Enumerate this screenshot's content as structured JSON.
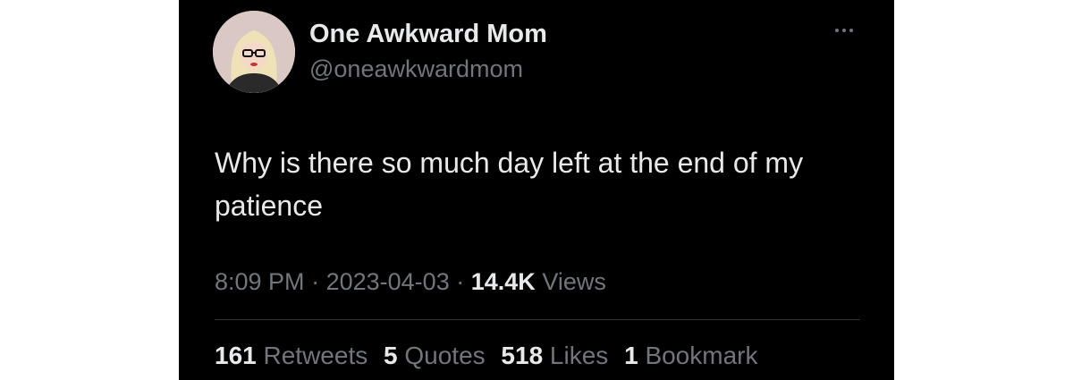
{
  "author": {
    "display_name": "One Awkward Mom",
    "handle": "@oneawkwardmom"
  },
  "tweet": {
    "text": "Why is there so much day left at the end of my patience"
  },
  "meta": {
    "time": "8:09 PM",
    "date": "2023-04-03",
    "separator": "·",
    "views_count": "14.4K",
    "views_label": "Views"
  },
  "stats": [
    {
      "count": "161",
      "label": "Retweets"
    },
    {
      "count": "5",
      "label": "Quotes"
    },
    {
      "count": "518",
      "label": "Likes"
    },
    {
      "count": "1",
      "label": "Bookmark"
    }
  ],
  "icons": {
    "more": "more-horizontal-icon",
    "avatar": "profile-photo"
  },
  "colors": {
    "background": "#000000",
    "primary_text": "#e7e9ea",
    "secondary_text": "#71767b",
    "divider": "#2f3336"
  }
}
